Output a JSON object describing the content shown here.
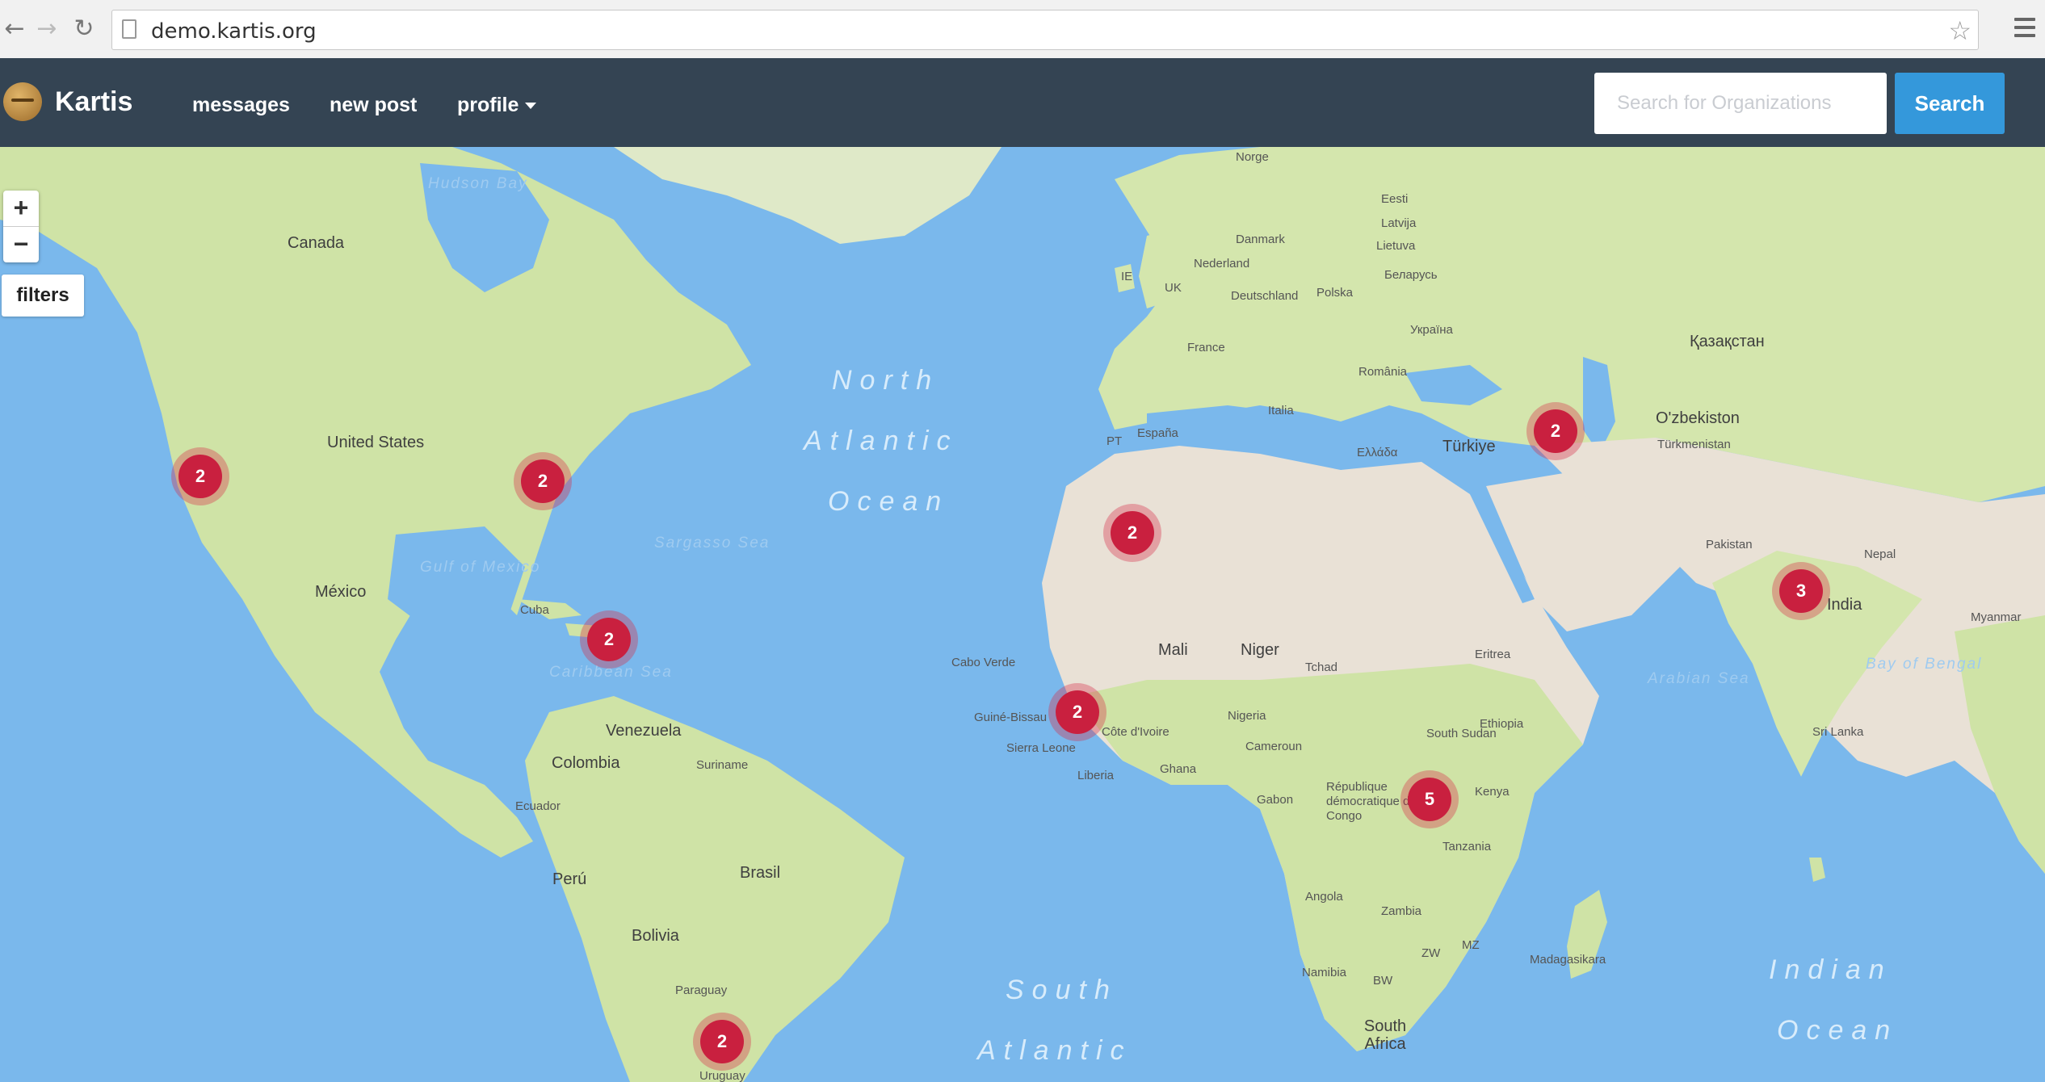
{
  "browser": {
    "url": "demo.kartis.org"
  },
  "navbar": {
    "brand": "Kartis",
    "links": {
      "messages": "messages",
      "new_post": "new post",
      "profile": "profile"
    },
    "search_placeholder": "Search for Organizations",
    "search_button": "Search"
  },
  "map": {
    "zoom_in": "+",
    "zoom_out": "−",
    "filters": "filters",
    "labels": {
      "canada": "Canada",
      "united_states": "United States",
      "mexico": "México",
      "cuba": "Cuba",
      "venezuela": "Venezuela",
      "colombia": "Colombia",
      "suriname": "Suriname",
      "ecuador": "Ecuador",
      "peru": "Perú",
      "brasil": "Brasil",
      "bolivia": "Bolivia",
      "paraguay": "Paraguay",
      "uruguay": "Uruguay",
      "norge": "Norge",
      "uk": "UK",
      "ie": "IE",
      "france": "France",
      "espana": "España",
      "pt": "PT",
      "nederland": "Nederland",
      "deutschland": "Deutschland",
      "danmark": "Danmark",
      "polska": "Polska",
      "eesti": "Eesti",
      "latvija": "Latvija",
      "lietuva": "Lietuva",
      "belarus": "Беларусь",
      "ukraine": "Україна",
      "romania": "România",
      "italia": "Italia",
      "ellada": "Ελλάδα",
      "turkiye": "Türkiye",
      "kazakhstan": "Қазақстан",
      "uzbekiston": "O'zbekiston",
      "turkmenistan": "Türkmenistan",
      "pakistan": "Pakistan",
      "nepal": "Nepal",
      "india": "India",
      "myanmar": "Myanmar",
      "sri_lanka": "Sri Lanka",
      "mali": "Mali",
      "niger": "Niger",
      "tchad": "Tchad",
      "nigeria": "Nigeria",
      "cabo_verde": "Cabo Verde",
      "guine_bissau": "Guiné-Bissau",
      "sierra_leone": "Sierra Leone",
      "liberia": "Liberia",
      "cote_divoire": "Côte d'Ivoire",
      "ghana": "Ghana",
      "cameroun": "Cameroun",
      "gabon": "Gabon",
      "rdc": "République démocratique du Congo",
      "south_sudan": "South Sudan",
      "ethiopia": "Ethiopia",
      "eritrea": "Eritrea",
      "kenya": "Kenya",
      "tanzania": "Tanzania",
      "angola": "Angola",
      "zambia": "Zambia",
      "namibia": "Namibia",
      "bw": "BW",
      "zw": "ZW",
      "mz": "MZ",
      "madagasikara": "Madagasikara",
      "south_africa": "South Africa",
      "hudson_bay": "Hudson Bay",
      "gulf_of_mexico": "Gulf of Mexico",
      "sargasso_sea": "Sargasso Sea",
      "caribbean_sea": "Caribbean Sea",
      "arabian_sea": "Arabian Sea",
      "bay_of_bengal": "Bay of Bengal",
      "north_atlantic_ocean": [
        "North",
        "Atlantic",
        "Ocean"
      ],
      "south_atlantic_ocean": [
        "South",
        "Atlantic"
      ],
      "indian_ocean": [
        "Indian",
        "Ocean"
      ]
    },
    "clusters": [
      {
        "id": "california",
        "count": "2"
      },
      {
        "id": "east-coast",
        "count": "2"
      },
      {
        "id": "caribbean",
        "count": "2"
      },
      {
        "id": "morocco",
        "count": "2"
      },
      {
        "id": "senegal",
        "count": "2"
      },
      {
        "id": "caucasus",
        "count": "2"
      },
      {
        "id": "india",
        "count": "3"
      },
      {
        "id": "east-africa",
        "count": "5"
      },
      {
        "id": "south-america",
        "count": "2"
      }
    ]
  },
  "colors": {
    "navbar": "#344453",
    "ocean": "#7ab8ec",
    "cluster": "#c9203f",
    "search_button": "#3498db"
  }
}
